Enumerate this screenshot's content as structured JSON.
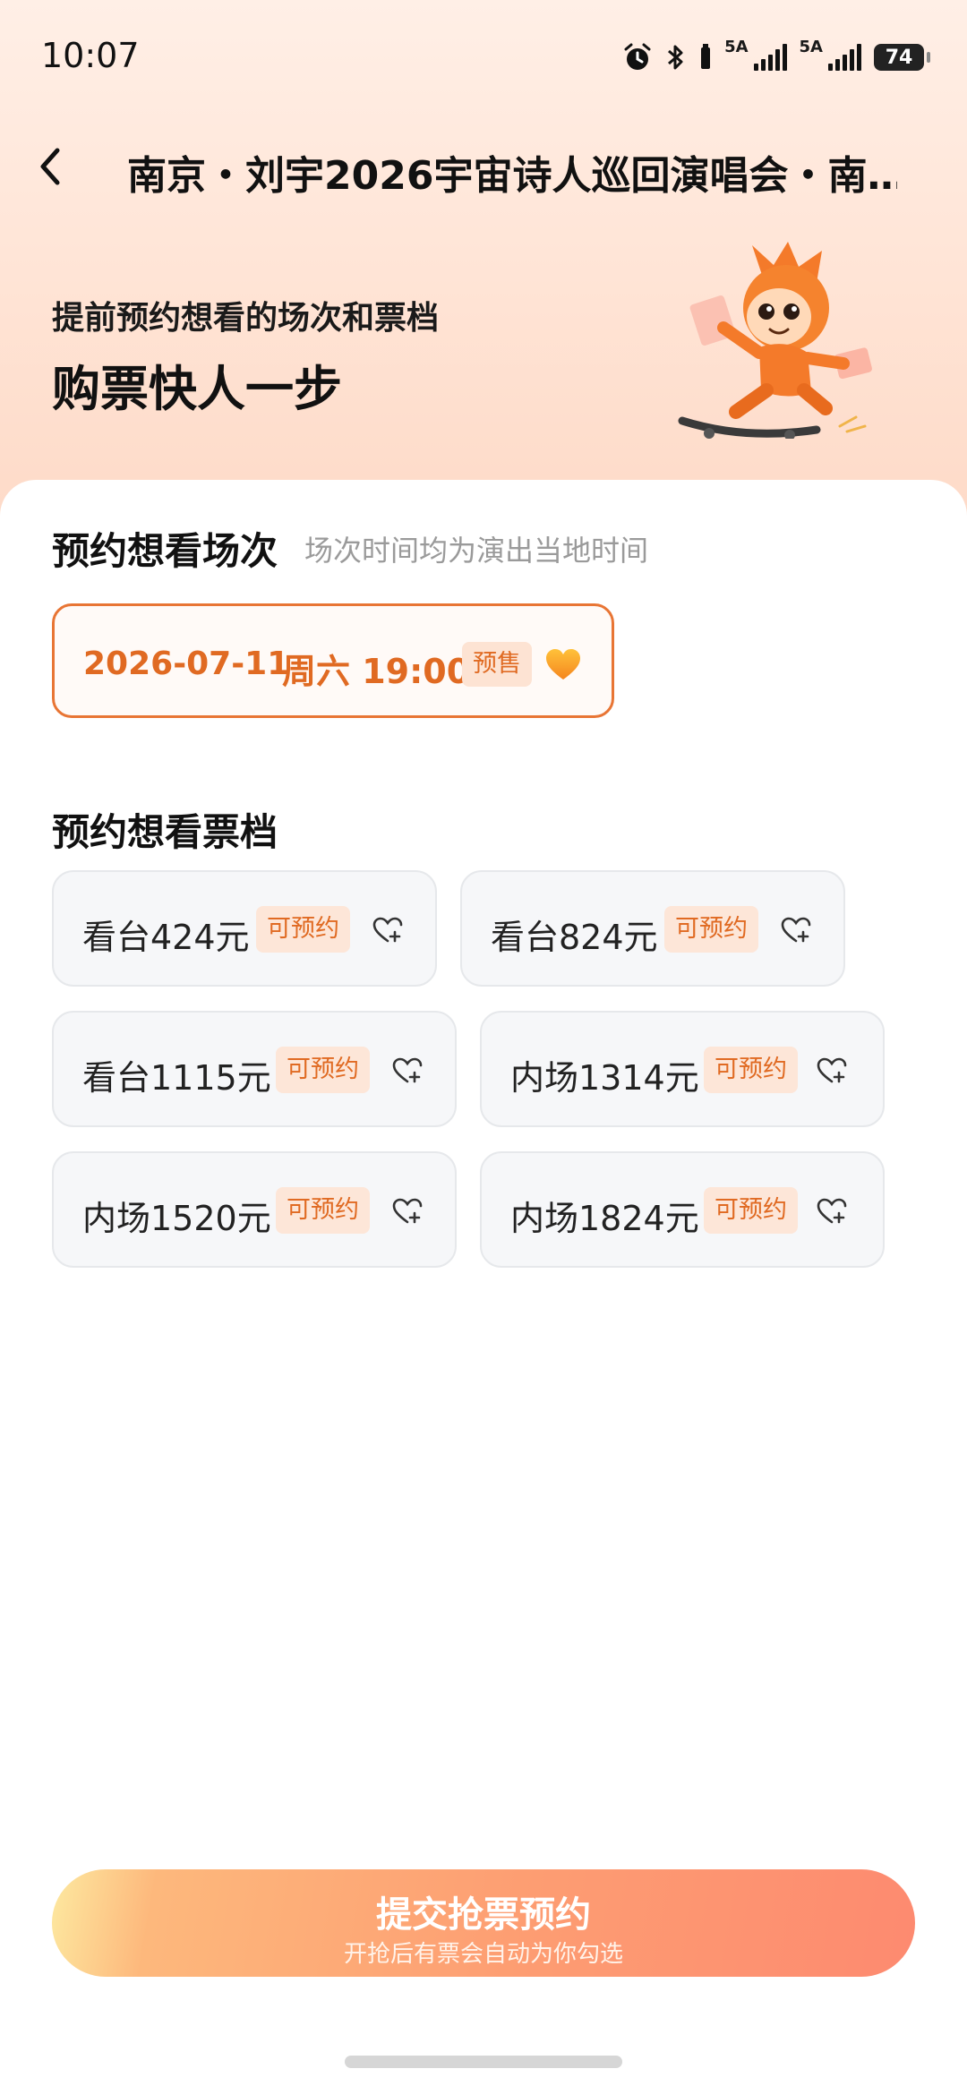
{
  "status_bar": {
    "time": "10:07",
    "net1": "5A",
    "net2": "5A",
    "battery": "74"
  },
  "header": {
    "title": "南京・刘宇2026宇宙诗人巡回演唱会・南…"
  },
  "hero": {
    "subtitle": "提前预约想看的场次和票档",
    "headline": "购票快人一步"
  },
  "sessions_section": {
    "title": "预约想看场次",
    "hint": "场次时间均为演出当地时间"
  },
  "sessions": [
    {
      "date": "2026-07-11",
      "time": "周六 19:00",
      "badge": "预售",
      "selected": true
    }
  ],
  "tiers_section": {
    "title": "预约想看票档"
  },
  "tiers": [
    {
      "name": "看台424元",
      "badge": "可预约"
    },
    {
      "name": "看台824元",
      "badge": "可预约"
    },
    {
      "name": "看台1115元",
      "badge": "可预约"
    },
    {
      "name": "内场1314元",
      "badge": "可预约"
    },
    {
      "name": "内场1520元",
      "badge": "可预约"
    },
    {
      "name": "内场1824元",
      "badge": "可预约"
    }
  ],
  "submit": {
    "label": "提交抢票预约",
    "sublabel": "开抢后有票会自动为你勾选"
  },
  "colors": {
    "accent": "#e06a22",
    "badge_bg": "#fde6d8",
    "tier_bg": "#f6f7f9",
    "hero_bg": "#ffe3d4"
  }
}
